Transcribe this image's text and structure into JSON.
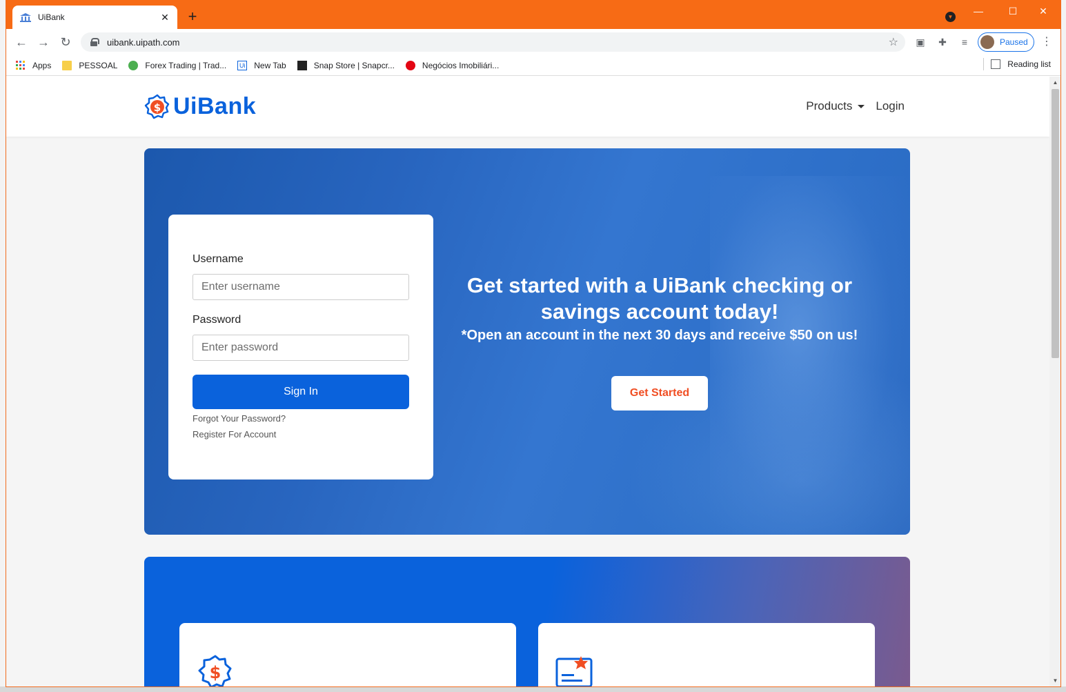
{
  "browser": {
    "tab_title": "UiBank",
    "url": "uibank.uipath.com",
    "profile_status": "Paused",
    "bookmarks": [
      {
        "label": "Apps"
      },
      {
        "label": "PESSOAL"
      },
      {
        "label": "Forex Trading | Trad..."
      },
      {
        "label": "New Tab"
      },
      {
        "label": "Snap Store | Snapcr..."
      },
      {
        "label": "Negócios Imobiliári..."
      }
    ],
    "reading_list": "Reading list"
  },
  "site": {
    "brand": "UiBank",
    "nav": {
      "products": "Products",
      "login": "Login"
    }
  },
  "login": {
    "username_label": "Username",
    "username_placeholder": "Enter username",
    "password_label": "Password",
    "password_placeholder": "Enter password",
    "signin": "Sign In",
    "forgot": "Forgot Your Password?",
    "register": "Register For Account"
  },
  "hero": {
    "headline": "Get started with a UiBank checking or savings account today!",
    "subline": "*Open an account in the next 30 days and receive $50 on us!",
    "cta": "Get Started"
  },
  "colors": {
    "brand_blue": "#0a62dc",
    "accent_orange": "#f04e23",
    "chrome_frame": "#f76b15"
  }
}
